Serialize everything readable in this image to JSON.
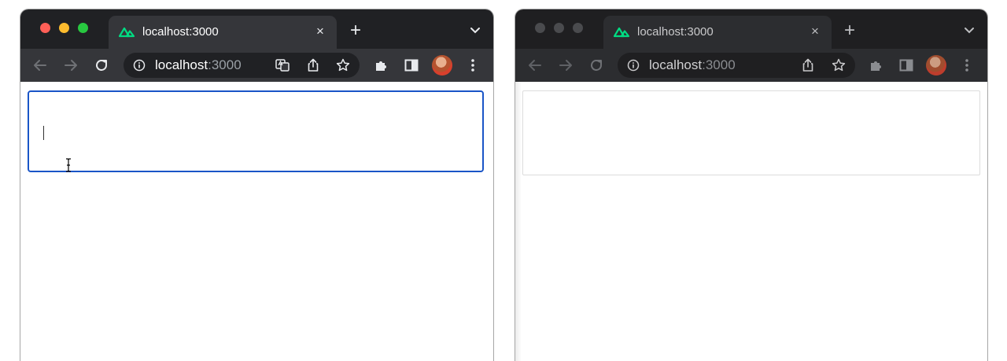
{
  "windows": [
    {
      "id": "left",
      "tab": {
        "title": "localhost:3000",
        "close": "×"
      },
      "new_tab": "+",
      "omnibox": {
        "host": "localhost",
        "port": ":3000"
      },
      "editor": {
        "state": "focused",
        "value": ""
      }
    },
    {
      "id": "right",
      "tab": {
        "title": "localhost:3000",
        "close": "×"
      },
      "new_tab": "+",
      "omnibox": {
        "host": "localhost",
        "port": ":3000"
      },
      "editor": {
        "state": "unfocused",
        "value": ""
      }
    }
  ],
  "icons": {
    "favicon": "nuxt-logo-icon",
    "back": "arrow-left-icon",
    "forward": "arrow-right-icon",
    "reload": "reload-icon",
    "info": "info-circle-icon",
    "translate": "translate-icon",
    "share": "share-icon",
    "bookmark": "star-icon",
    "extensions": "puzzle-icon",
    "sidepanel": "side-panel-icon",
    "profile": "avatar",
    "menu": "kebab-menu-icon",
    "tab_search": "chevron-down-icon"
  },
  "colors": {
    "titlebar": "#202124",
    "toolbar": "#35363a",
    "nuxt_green": "#00dc82",
    "focus_border": "#1a55c7",
    "traffic_close": "#ff5f57",
    "traffic_min": "#febc2e",
    "traffic_max": "#28c840"
  }
}
